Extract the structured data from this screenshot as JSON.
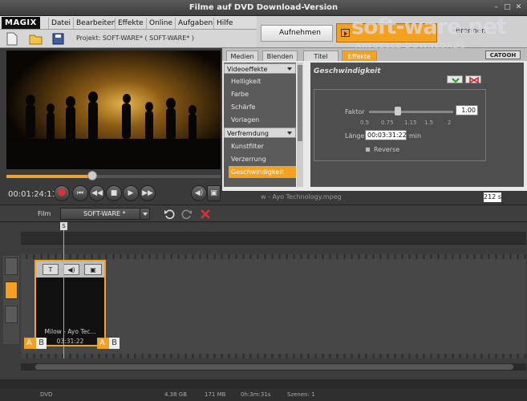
{
  "window": {
    "title": "Filme auf DVD Download-Version"
  },
  "menubar": {
    "logo": "MAGIX",
    "items": [
      "Datei",
      "Bearbeiten",
      "Effekte",
      "Online",
      "Aufgaben",
      "Hilfe"
    ]
  },
  "toolbar": {
    "project": "Projekt: SOFT-WARE* ( SOFT-WARE* )"
  },
  "recorder": {
    "aufnehmen": "Aufnehmen"
  },
  "watermark": {
    "brand": "soft-ware.net",
    "tagline": "AKTUELLE DOWNLOADS",
    "hidden_text": "Brennen"
  },
  "player": {
    "timecode": "00:01:24:11",
    "progress": 0.4
  },
  "effects": {
    "tabs": [
      "Medien",
      "Blenden",
      "Titel",
      "Effekte"
    ],
    "active_tab": "Effekte",
    "catooh": "CATOOH",
    "groups": [
      {
        "label": "Videoeffekte",
        "items": [
          "Helligkeit",
          "Farbe",
          "Schärfe",
          "Vorlagen"
        ]
      },
      {
        "label": "Verfremdung",
        "items": [
          "Kunstfilter",
          "Verzerrung",
          "Geschwindigkeit"
        ]
      }
    ],
    "selected": "Geschwindigkeit",
    "panel_title": "Geschwindigkeit",
    "faktor_label": "Faktor",
    "faktor_value": "1.00",
    "faktor_ticks": [
      "0.5",
      "0.75",
      "1.15",
      "1.5",
      "2"
    ],
    "laenge_label": "Länge",
    "laenge_value": "00:03:31:22",
    "laenge_unit": "min",
    "reverse_label": "Reverse",
    "file_name": "w - Ayo Technology.mpeg",
    "file_num": "212 s"
  },
  "film": {
    "label": "Film",
    "selected": "SOFT-WARE *"
  },
  "timeline": {
    "marker": "S",
    "clip_title": "Milow - Ayo Tec...",
    "clip_time": "03:31:22",
    "ab_a": "A",
    "ab_b": "B"
  },
  "status": {
    "medium": "DVD",
    "size": "4.38 GB",
    "used": "171 MB",
    "duration": "0h:3m:31s",
    "scenes": "Szenen: 1"
  }
}
